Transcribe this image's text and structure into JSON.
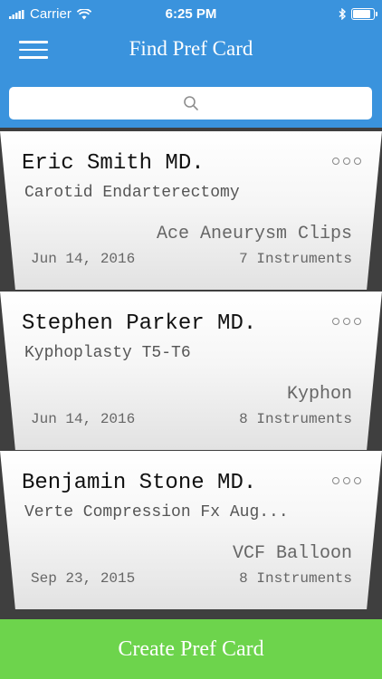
{
  "status_bar": {
    "carrier": "Carrier",
    "time": "6:25 PM"
  },
  "nav": {
    "title": "Find Pref Card"
  },
  "search": {
    "placeholder": "",
    "value": ""
  },
  "cards": [
    {
      "doctor": "Eric Smith MD.",
      "procedure": "Carotid Endarterectomy",
      "device": "Ace Aneurysm Clips",
      "date": "Jun 14, 2016",
      "instruments": "7 Instruments"
    },
    {
      "doctor": "Stephen Parker MD.",
      "procedure": "Kyphoplasty T5-T6",
      "device": "Kyphon",
      "date": "Jun 14, 2016",
      "instruments": "8 Instruments"
    },
    {
      "doctor": "Benjamin Stone MD.",
      "procedure": "Verte Compression Fx Aug...",
      "device": "VCF Balloon",
      "date": "Sep 23, 2015",
      "instruments": "8 Instruments"
    }
  ],
  "footer": {
    "create_label": "Create Pref Card"
  },
  "colors": {
    "header": "#3a93dd",
    "create_button": "#6dd44c",
    "background": "#3f3f3f"
  },
  "icons": [
    "signal-bars-icon",
    "wifi-icon",
    "bluetooth-icon",
    "battery-icon",
    "hamburger-menu-icon",
    "search-icon",
    "more-options-icon"
  ]
}
